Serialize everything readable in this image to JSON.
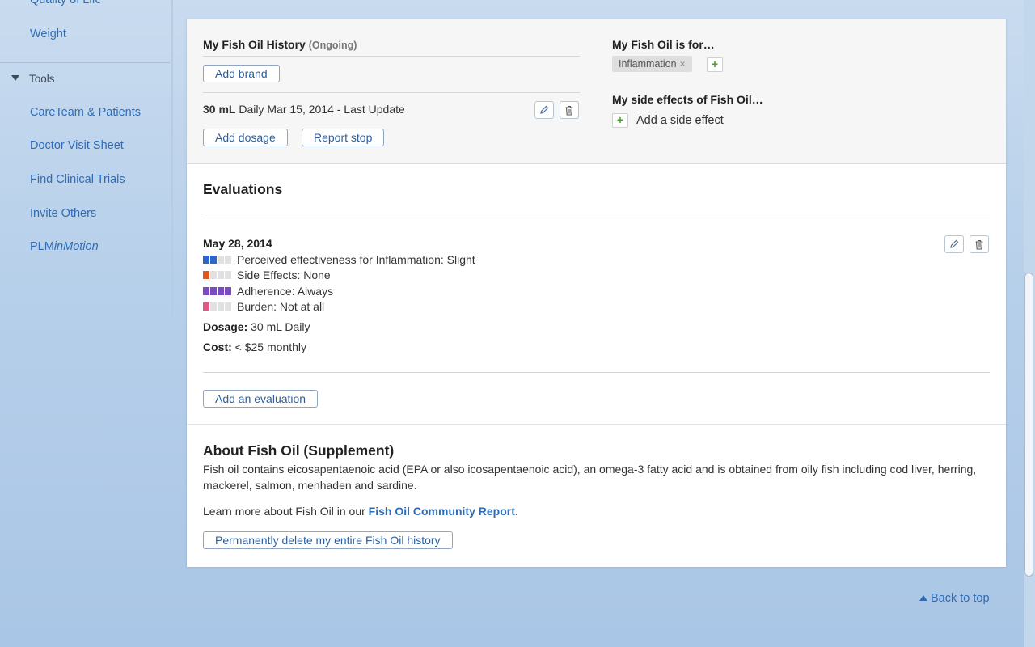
{
  "sidebar": {
    "items_top": [
      {
        "label": "Quality of Life"
      },
      {
        "label": "Weight"
      }
    ],
    "tools_heading": "Tools",
    "tools_items": [
      {
        "label": "CareTeam & Patients"
      },
      {
        "label": "Doctor Visit Sheet"
      },
      {
        "label": "Find Clinical Trials"
      },
      {
        "label": "Invite Others"
      }
    ],
    "plm_prefix": "PLM",
    "plm_suffix": "inMotion"
  },
  "history": {
    "title": "My Fish Oil History",
    "status": "(Ongoing)",
    "add_brand_label": "Add brand",
    "dosage_amount": "30 mL",
    "dosage_detail": "Daily Mar 15, 2014 - Last Update",
    "add_dosage_label": "Add dosage",
    "report_stop_label": "Report stop"
  },
  "purpose": {
    "title": "My Fish Oil is for…",
    "tag": "Inflammation",
    "tag_remove": "×",
    "add": "+"
  },
  "side_effects": {
    "title": "My side effects of Fish Oil…",
    "add": "+",
    "add_label": "Add a side effect"
  },
  "evaluations": {
    "title": "Evaluations",
    "entry": {
      "date": "May 28, 2014",
      "ratings": [
        {
          "label": "Perceived effectiveness for Inflammation: Slight",
          "level": 2,
          "max": 4,
          "color": "#2f64c8"
        },
        {
          "label": "Side Effects: None",
          "level": 1,
          "max": 4,
          "color": "#e0561c"
        },
        {
          "label": "Adherence: Always",
          "level": 4,
          "max": 4,
          "color": "#7b4bbf"
        },
        {
          "label": "Burden: Not at all",
          "level": 1,
          "max": 4,
          "color": "#e0578a"
        }
      ],
      "dosage_label": "Dosage:",
      "dosage_value": "30 mL Daily",
      "cost_label": "Cost:",
      "cost_value": "< $25 monthly"
    },
    "add_label": "Add an evaluation"
  },
  "about": {
    "title": "About Fish Oil (Supplement)",
    "text": "Fish oil contains eicosapentaenoic acid (EPA or also icosapentaenoic acid), an omega-3 fatty acid and is obtained from oily fish including cod liver, herring, mackerel, salmon, menhaden and sardine.",
    "learn_prefix": "Learn more about Fish Oil in our",
    "learn_link": "Fish Oil Community Report",
    "learn_suffix": ".",
    "delete_label": "Permanently delete my entire Fish Oil history"
  },
  "footer": {
    "back_to_top": "Back to top"
  }
}
